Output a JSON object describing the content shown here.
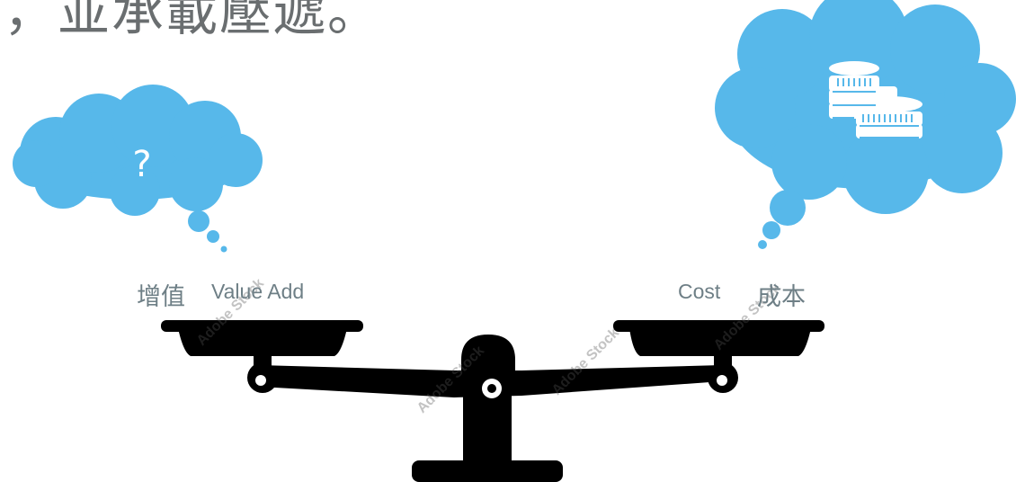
{
  "header": {
    "title_partial": "，並承載壓遞。"
  },
  "left_thought": {
    "symbol": "?",
    "color": "#57b8ea"
  },
  "right_thought": {
    "icon": "coins-icon",
    "color": "#57b8ea"
  },
  "labels": {
    "left_cn": "增值",
    "left_en": "Value Add",
    "right_en": "Cost",
    "right_cn": "成本"
  },
  "scale": {
    "icon": "balance-scale-icon",
    "color": "#000000"
  },
  "watermark": {
    "text": "Adobe Stock"
  }
}
